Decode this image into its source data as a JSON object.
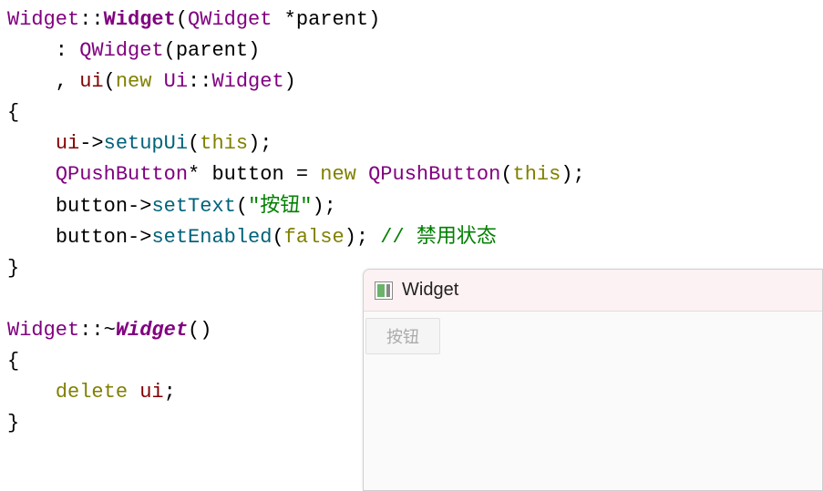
{
  "code": {
    "l1_cls1": "Widget",
    "l1_op": "::",
    "l1_ctor": "Widget",
    "l1_open": "(",
    "l1_type": "QWidget",
    "l1_ptr": " *",
    "l1_param": "parent",
    "l1_close": ")",
    "l2_prefix": "    : ",
    "l2_base": "QWidget",
    "l2_open": "(",
    "l2_arg": "parent",
    "l2_close": ")",
    "l3_prefix": "    , ",
    "l3_member": "ui",
    "l3_open": "(",
    "l3_new": "new",
    "l3_ns": " Ui",
    "l3_op": "::",
    "l3_cls": "Widget",
    "l3_close": ")",
    "l4_brace": "{",
    "l5_prefix": "    ",
    "l5_obj": "ui",
    "l5_arrow": "->",
    "l5_method": "setupUi",
    "l5_open": "(",
    "l5_this": "this",
    "l5_close": ");",
    "l6_prefix": "    ",
    "l6_type": "QPushButton",
    "l6_ptr": "* ",
    "l6_var": "button",
    "l6_eq": " = ",
    "l6_new": "new",
    "l6_cls": " QPushButton",
    "l6_open": "(",
    "l6_this": "this",
    "l6_close": ");",
    "l7_prefix": "    ",
    "l7_obj": "button",
    "l7_arrow": "->",
    "l7_method": "setText",
    "l7_open": "(",
    "l7_str": "\"按钮\"",
    "l7_close": ");",
    "l8_prefix": "    ",
    "l8_obj": "button",
    "l8_arrow": "->",
    "l8_method": "setEnabled",
    "l8_open": "(",
    "l8_arg": "false",
    "l8_close": "); ",
    "l8_comment": "// 禁用状态",
    "l9_brace": "}",
    "l10_blank": "",
    "l11_cls": "Widget",
    "l11_op": "::~",
    "l11_dtor": "Widget",
    "l11_parens": "()",
    "l12_brace": "{",
    "l13_prefix": "    ",
    "l13_kw": "delete",
    "l13_sp": " ",
    "l13_obj": "ui",
    "l13_semi": ";",
    "l14_brace": "}"
  },
  "window": {
    "title": "Widget",
    "button_label": "按钮"
  }
}
